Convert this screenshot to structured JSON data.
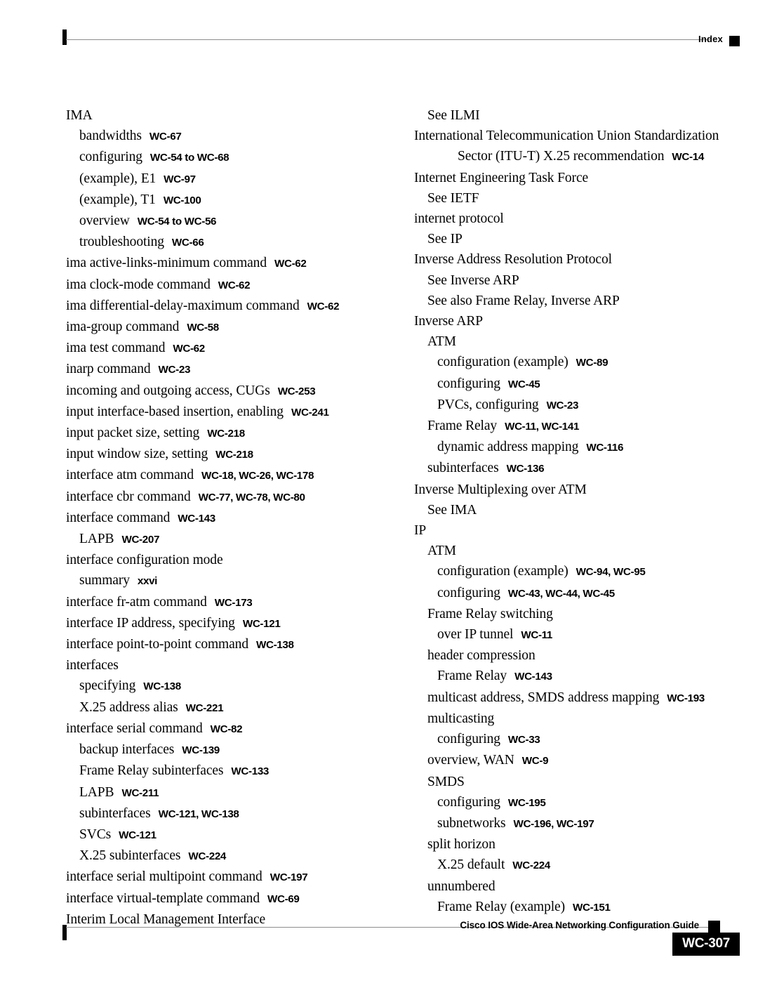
{
  "header": {
    "label": "Index",
    "marker_icon": "black-square"
  },
  "footer": {
    "guide_title": "Cisco IOS Wide-Area Networking Configuration Guide",
    "marker_icon": "black-square",
    "page_number": "WC-307"
  },
  "index": {
    "left_column": [
      {
        "level": 0,
        "term": "IMA",
        "pages": ""
      },
      {
        "level": 1,
        "term": "bandwidths",
        "pages": "WC-67"
      },
      {
        "level": 1,
        "term": "configuring",
        "pages": "WC-54 to WC-68"
      },
      {
        "level": 1,
        "term": "(example), E1",
        "pages": "WC-97"
      },
      {
        "level": 1,
        "term": "(example), T1",
        "pages": "WC-100"
      },
      {
        "level": 1,
        "term": "overview",
        "pages": "WC-54 to WC-56"
      },
      {
        "level": 1,
        "term": "troubleshooting",
        "pages": "WC-66"
      },
      {
        "level": 0,
        "term": "ima active-links-minimum command",
        "pages": "WC-62"
      },
      {
        "level": 0,
        "term": "ima clock-mode command",
        "pages": "WC-62"
      },
      {
        "level": 0,
        "term": "ima differential-delay-maximum command",
        "pages": "WC-62"
      },
      {
        "level": 0,
        "term": "ima-group command",
        "pages": "WC-58"
      },
      {
        "level": 0,
        "term": "ima test command",
        "pages": "WC-62"
      },
      {
        "level": 0,
        "term": "inarp command",
        "pages": "WC-23"
      },
      {
        "level": 0,
        "term": "incoming and outgoing access, CUGs",
        "pages": "WC-253"
      },
      {
        "level": 0,
        "term": "input interface-based insertion, enabling",
        "pages": "WC-241"
      },
      {
        "level": 0,
        "term": "input packet size, setting",
        "pages": "WC-218"
      },
      {
        "level": 0,
        "term": "input window size, setting",
        "pages": "WC-218"
      },
      {
        "level": 0,
        "term": "interface atm command",
        "pages": "WC-18, WC-26, WC-178"
      },
      {
        "level": 0,
        "term": "interface cbr command",
        "pages": "WC-77, WC-78, WC-80"
      },
      {
        "level": 0,
        "term": "interface command",
        "pages": "WC-143"
      },
      {
        "level": 1,
        "term": "LAPB",
        "pages": "WC-207"
      },
      {
        "level": 0,
        "term": "interface configuration mode",
        "pages": ""
      },
      {
        "level": 1,
        "term": "summary",
        "pages": "xxvi"
      },
      {
        "level": 0,
        "term": "interface fr-atm command",
        "pages": "WC-173"
      },
      {
        "level": 0,
        "term": "interface IP address, specifying",
        "pages": "WC-121"
      },
      {
        "level": 0,
        "term": "interface point-to-point command",
        "pages": "WC-138"
      },
      {
        "level": 0,
        "term": "interfaces",
        "pages": ""
      },
      {
        "level": 1,
        "term": "specifying",
        "pages": "WC-138"
      },
      {
        "level": 1,
        "term": "X.25 address alias",
        "pages": "WC-221"
      },
      {
        "level": 0,
        "term": "interface serial command",
        "pages": "WC-82"
      },
      {
        "level": 1,
        "term": "backup interfaces",
        "pages": "WC-139"
      },
      {
        "level": 1,
        "term": "Frame Relay subinterfaces",
        "pages": "WC-133"
      },
      {
        "level": 1,
        "term": "LAPB",
        "pages": "WC-211"
      },
      {
        "level": 1,
        "term": "subinterfaces",
        "pages": "WC-121, WC-138"
      },
      {
        "level": 1,
        "term": "SVCs",
        "pages": "WC-121"
      },
      {
        "level": 1,
        "term": "X.25 subinterfaces",
        "pages": "WC-224"
      },
      {
        "level": 0,
        "term": "interface serial multipoint command",
        "pages": "WC-197"
      },
      {
        "level": 0,
        "term": "interface virtual-template command",
        "pages": "WC-69"
      },
      {
        "level": 0,
        "term": "Interim Local Management Interface",
        "pages": ""
      }
    ],
    "right_column": [
      {
        "level": 1,
        "term": "See ILMI",
        "pages": ""
      },
      {
        "level": 0,
        "term": "International Telecommunication Union Standardization",
        "term2": "Sector (ITU-T) X.25 recommendation",
        "pages": "WC-14"
      },
      {
        "level": 0,
        "term": "Internet Engineering Task Force",
        "pages": ""
      },
      {
        "level": 1,
        "term": "See IETF",
        "pages": ""
      },
      {
        "level": 0,
        "term": "internet protocol",
        "pages": ""
      },
      {
        "level": 1,
        "term": "See IP",
        "pages": ""
      },
      {
        "level": 0,
        "term": "Inverse Address Resolution Protocol",
        "pages": ""
      },
      {
        "level": 1,
        "term": "See Inverse ARP",
        "pages": ""
      },
      {
        "level": 1,
        "term": "See also Frame Relay, Inverse ARP",
        "pages": ""
      },
      {
        "level": 0,
        "term": "Inverse ARP",
        "pages": ""
      },
      {
        "level": 1,
        "term": "ATM",
        "pages": ""
      },
      {
        "level": 2,
        "term": "configuration (example)",
        "pages": "WC-89"
      },
      {
        "level": 2,
        "term": "configuring",
        "pages": "WC-45"
      },
      {
        "level": 2,
        "term": "PVCs, configuring",
        "pages": "WC-23"
      },
      {
        "level": 1,
        "term": "Frame Relay",
        "pages": "WC-11, WC-141"
      },
      {
        "level": 2,
        "term": "dynamic address mapping",
        "pages": "WC-116"
      },
      {
        "level": 1,
        "term": "subinterfaces",
        "pages": "WC-136"
      },
      {
        "level": 0,
        "term": "Inverse Multiplexing over ATM",
        "pages": ""
      },
      {
        "level": 1,
        "term": "See IMA",
        "pages": ""
      },
      {
        "level": 0,
        "term": "IP",
        "pages": ""
      },
      {
        "level": 1,
        "term": "ATM",
        "pages": ""
      },
      {
        "level": 2,
        "term": "configuration (example)",
        "pages": "WC-94, WC-95"
      },
      {
        "level": 2,
        "term": "configuring",
        "pages": "WC-43, WC-44, WC-45"
      },
      {
        "level": 1,
        "term": "Frame Relay switching",
        "pages": ""
      },
      {
        "level": 2,
        "term": "over IP tunnel",
        "pages": "WC-11"
      },
      {
        "level": 1,
        "term": "header compression",
        "pages": ""
      },
      {
        "level": 2,
        "term": "Frame Relay",
        "pages": "WC-143"
      },
      {
        "level": 1,
        "term": "multicast address, SMDS address mapping",
        "pages": "WC-193"
      },
      {
        "level": 1,
        "term": "multicasting",
        "pages": ""
      },
      {
        "level": 2,
        "term": "configuring",
        "pages": "WC-33"
      },
      {
        "level": 1,
        "term": "overview, WAN",
        "pages": "WC-9"
      },
      {
        "level": 1,
        "term": "SMDS",
        "pages": ""
      },
      {
        "level": 2,
        "term": "configuring",
        "pages": "WC-195"
      },
      {
        "level": 2,
        "term": "subnetworks",
        "pages": "WC-196, WC-197"
      },
      {
        "level": 1,
        "term": "split horizon",
        "pages": ""
      },
      {
        "level": 2,
        "term": "X.25 default",
        "pages": "WC-224"
      },
      {
        "level": 1,
        "term": "unnumbered",
        "pages": ""
      },
      {
        "level": 2,
        "term": "Frame Relay (example)",
        "pages": "WC-151"
      }
    ]
  }
}
